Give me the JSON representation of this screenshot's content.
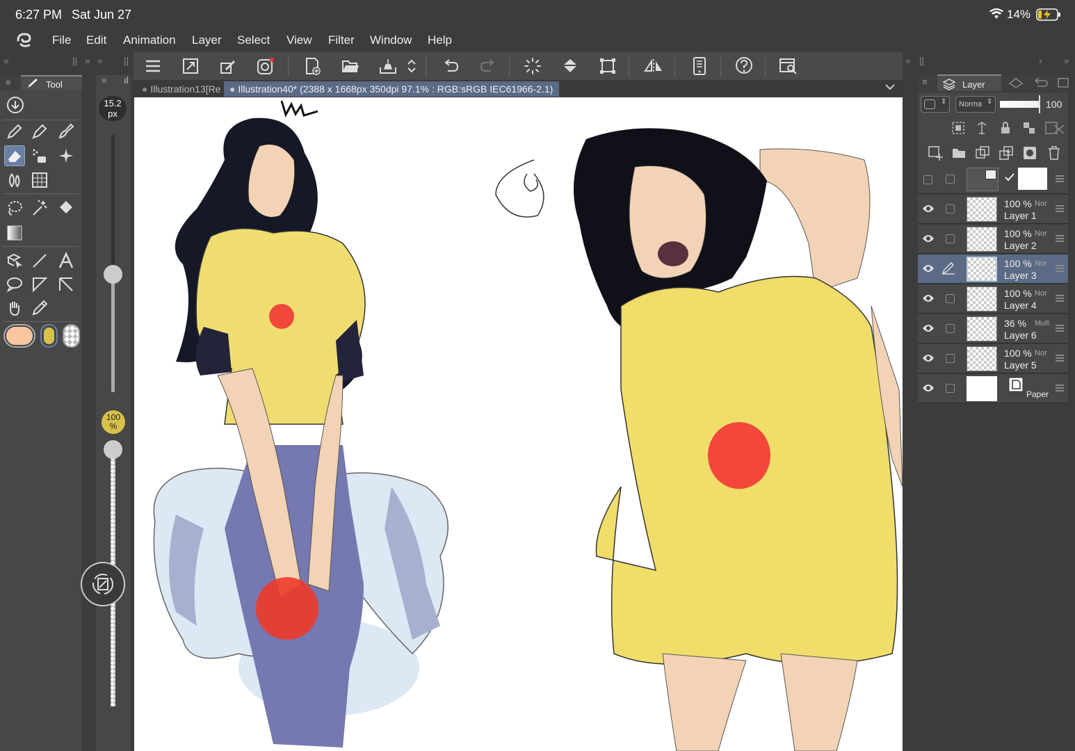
{
  "status": {
    "time": "6:27 PM",
    "date": "Sat Jun 27",
    "battery": "14%"
  },
  "menu": [
    "File",
    "Edit",
    "Animation",
    "Layer",
    "Select",
    "View",
    "Filter",
    "Window",
    "Help"
  ],
  "tabs": [
    {
      "label": "Illustration13[Re"
    },
    {
      "label": "Illustration40* (2388 x 1668px 350dpi 97.1% : RGB:sRGB IEC61966-2.1)"
    }
  ],
  "tool_panel": {
    "title": "Tool"
  },
  "brush": {
    "size_value": "15.2",
    "size_unit": "px",
    "opacity_value": "100",
    "opacity_unit": "%",
    "size_fraction": 0.46,
    "opacity_fraction": 0.98
  },
  "colors": {
    "main": "#f9c6a0",
    "sub": "#d8c14a",
    "accent": "#5b6a85"
  },
  "layer_panel": {
    "title": "Layer",
    "blend_mode": "Norma",
    "opacity": "100",
    "layers": [
      {
        "pct": "",
        "mode": "",
        "name": ""
      },
      {
        "pct": "100 %",
        "mode": "Nor",
        "name": "Layer 1"
      },
      {
        "pct": "100 %",
        "mode": "Nor",
        "name": "Layer 2"
      },
      {
        "pct": "100 %",
        "mode": "Nor",
        "name": "Layer 3"
      },
      {
        "pct": "100 %",
        "mode": "Nor",
        "name": "Layer 4"
      },
      {
        "pct": "36 %",
        "mode": "Mult",
        "name": "Layer 6"
      },
      {
        "pct": "100 %",
        "mode": "Nor",
        "name": "Layer 5"
      },
      {
        "pct": "",
        "mode": "",
        "name": "Paper"
      }
    ]
  }
}
